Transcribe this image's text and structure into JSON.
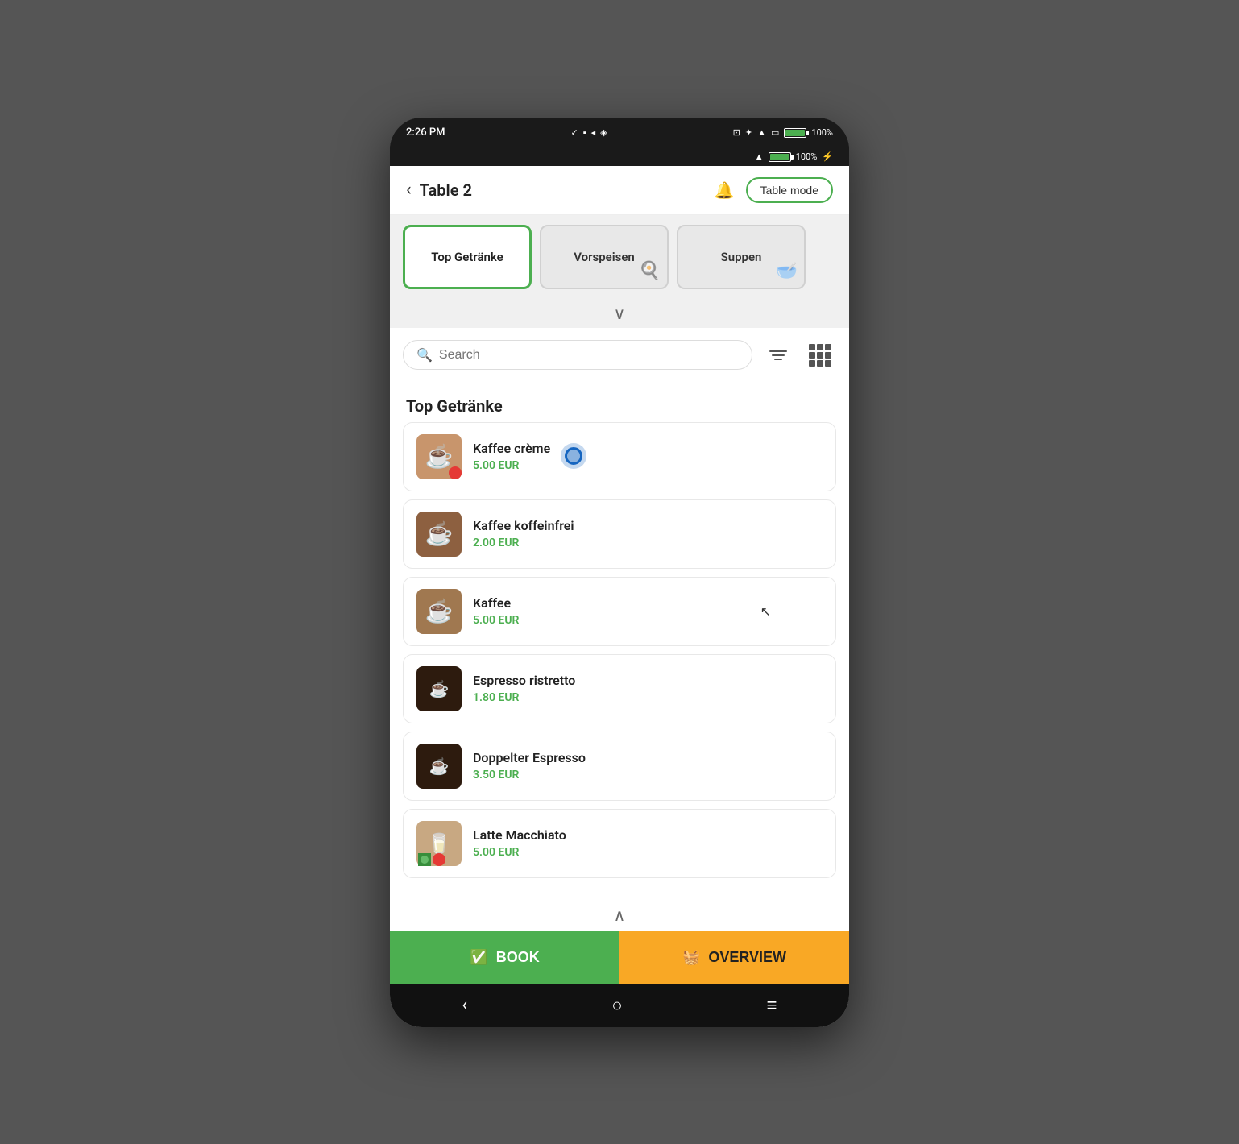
{
  "status": {
    "time": "2:26 PM",
    "battery_pct": "100%",
    "wifi": "WiFi",
    "bluetooth": "BT",
    "battery_pct2": "100%"
  },
  "header": {
    "title": "Table 2",
    "back_label": "‹",
    "table_mode_label": "Table mode"
  },
  "categories": [
    {
      "id": "top-getraenke",
      "label": "Top Getränke",
      "active": true
    },
    {
      "id": "vorspeisen",
      "label": "Vorspeisen",
      "active": false
    },
    {
      "id": "suppen",
      "label": "Suppen",
      "active": false
    }
  ],
  "search": {
    "placeholder": "Search"
  },
  "section_title": "Top Getränke",
  "menu_items": [
    {
      "id": 1,
      "name": "Kaffee crème",
      "price": "5.00 EUR",
      "emoji": "☕",
      "img_class": "img-kaffee-creme",
      "badge": "red"
    },
    {
      "id": 2,
      "name": "Kaffee koffeinfrei",
      "price": "2.00 EUR",
      "emoji": "☕",
      "img_class": "img-kaffee-kofe",
      "badge": "none"
    },
    {
      "id": 3,
      "name": "Kaffee",
      "price": "5.00 EUR",
      "emoji": "☕",
      "img_class": "img-kaffee",
      "badge": "none"
    },
    {
      "id": 4,
      "name": "Espresso ristretto",
      "price": "1.80 EUR",
      "emoji": "☕",
      "img_class": "img-espresso",
      "badge": "none"
    },
    {
      "id": 5,
      "name": "Doppelter Espresso",
      "price": "3.50 EUR",
      "emoji": "☕",
      "img_class": "img-doppelt",
      "badge": "none"
    },
    {
      "id": 6,
      "name": "Latte Macchiato",
      "price": "5.00 EUR",
      "emoji": "🥛",
      "img_class": "img-latte",
      "badge": "green-red"
    }
  ],
  "actions": {
    "book_label": "BOOK",
    "overview_label": "OVERVIEW"
  },
  "nav": {
    "back": "‹",
    "home": "○",
    "menu": "≡"
  },
  "colors": {
    "green": "#4caf50",
    "yellow": "#f9a825",
    "red": "#e53935",
    "blue": "#1565c0"
  }
}
